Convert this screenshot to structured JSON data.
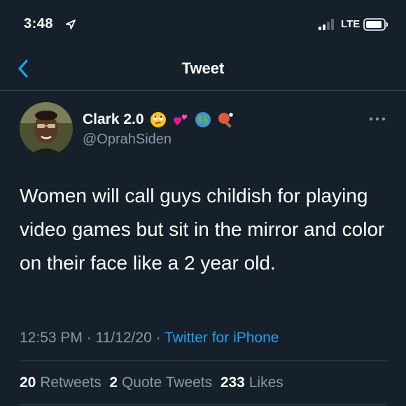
{
  "status_bar": {
    "time": "3:48",
    "network": "LTE"
  },
  "nav": {
    "title": "Tweet"
  },
  "author": {
    "display_name": "Clark 2.0",
    "handle": "@OprahSiden",
    "emoji_icons": [
      "rolling-eyes-face",
      "two-hearts",
      "globe-americas",
      "ping-pong"
    ]
  },
  "tweet": {
    "text": "Women will call guys childish for playing video games but sit in the mirror and color on their face like a 2 year old."
  },
  "meta": {
    "time": "12:53 PM",
    "separator1": " · ",
    "date": "11/12/20",
    "separator2": " · ",
    "source": "Twitter for iPhone"
  },
  "stats": {
    "retweets_count": "20",
    "retweets_label": "Retweets",
    "quote_tweets_count": "2",
    "quote_tweets_label": "Quote Tweets",
    "likes_count": "233",
    "likes_label": "Likes"
  },
  "colors": {
    "background": "#15202b",
    "text_primary": "#ffffff",
    "text_secondary": "#8899a6",
    "accent": "#1da1f2",
    "divider": "#38444d"
  }
}
